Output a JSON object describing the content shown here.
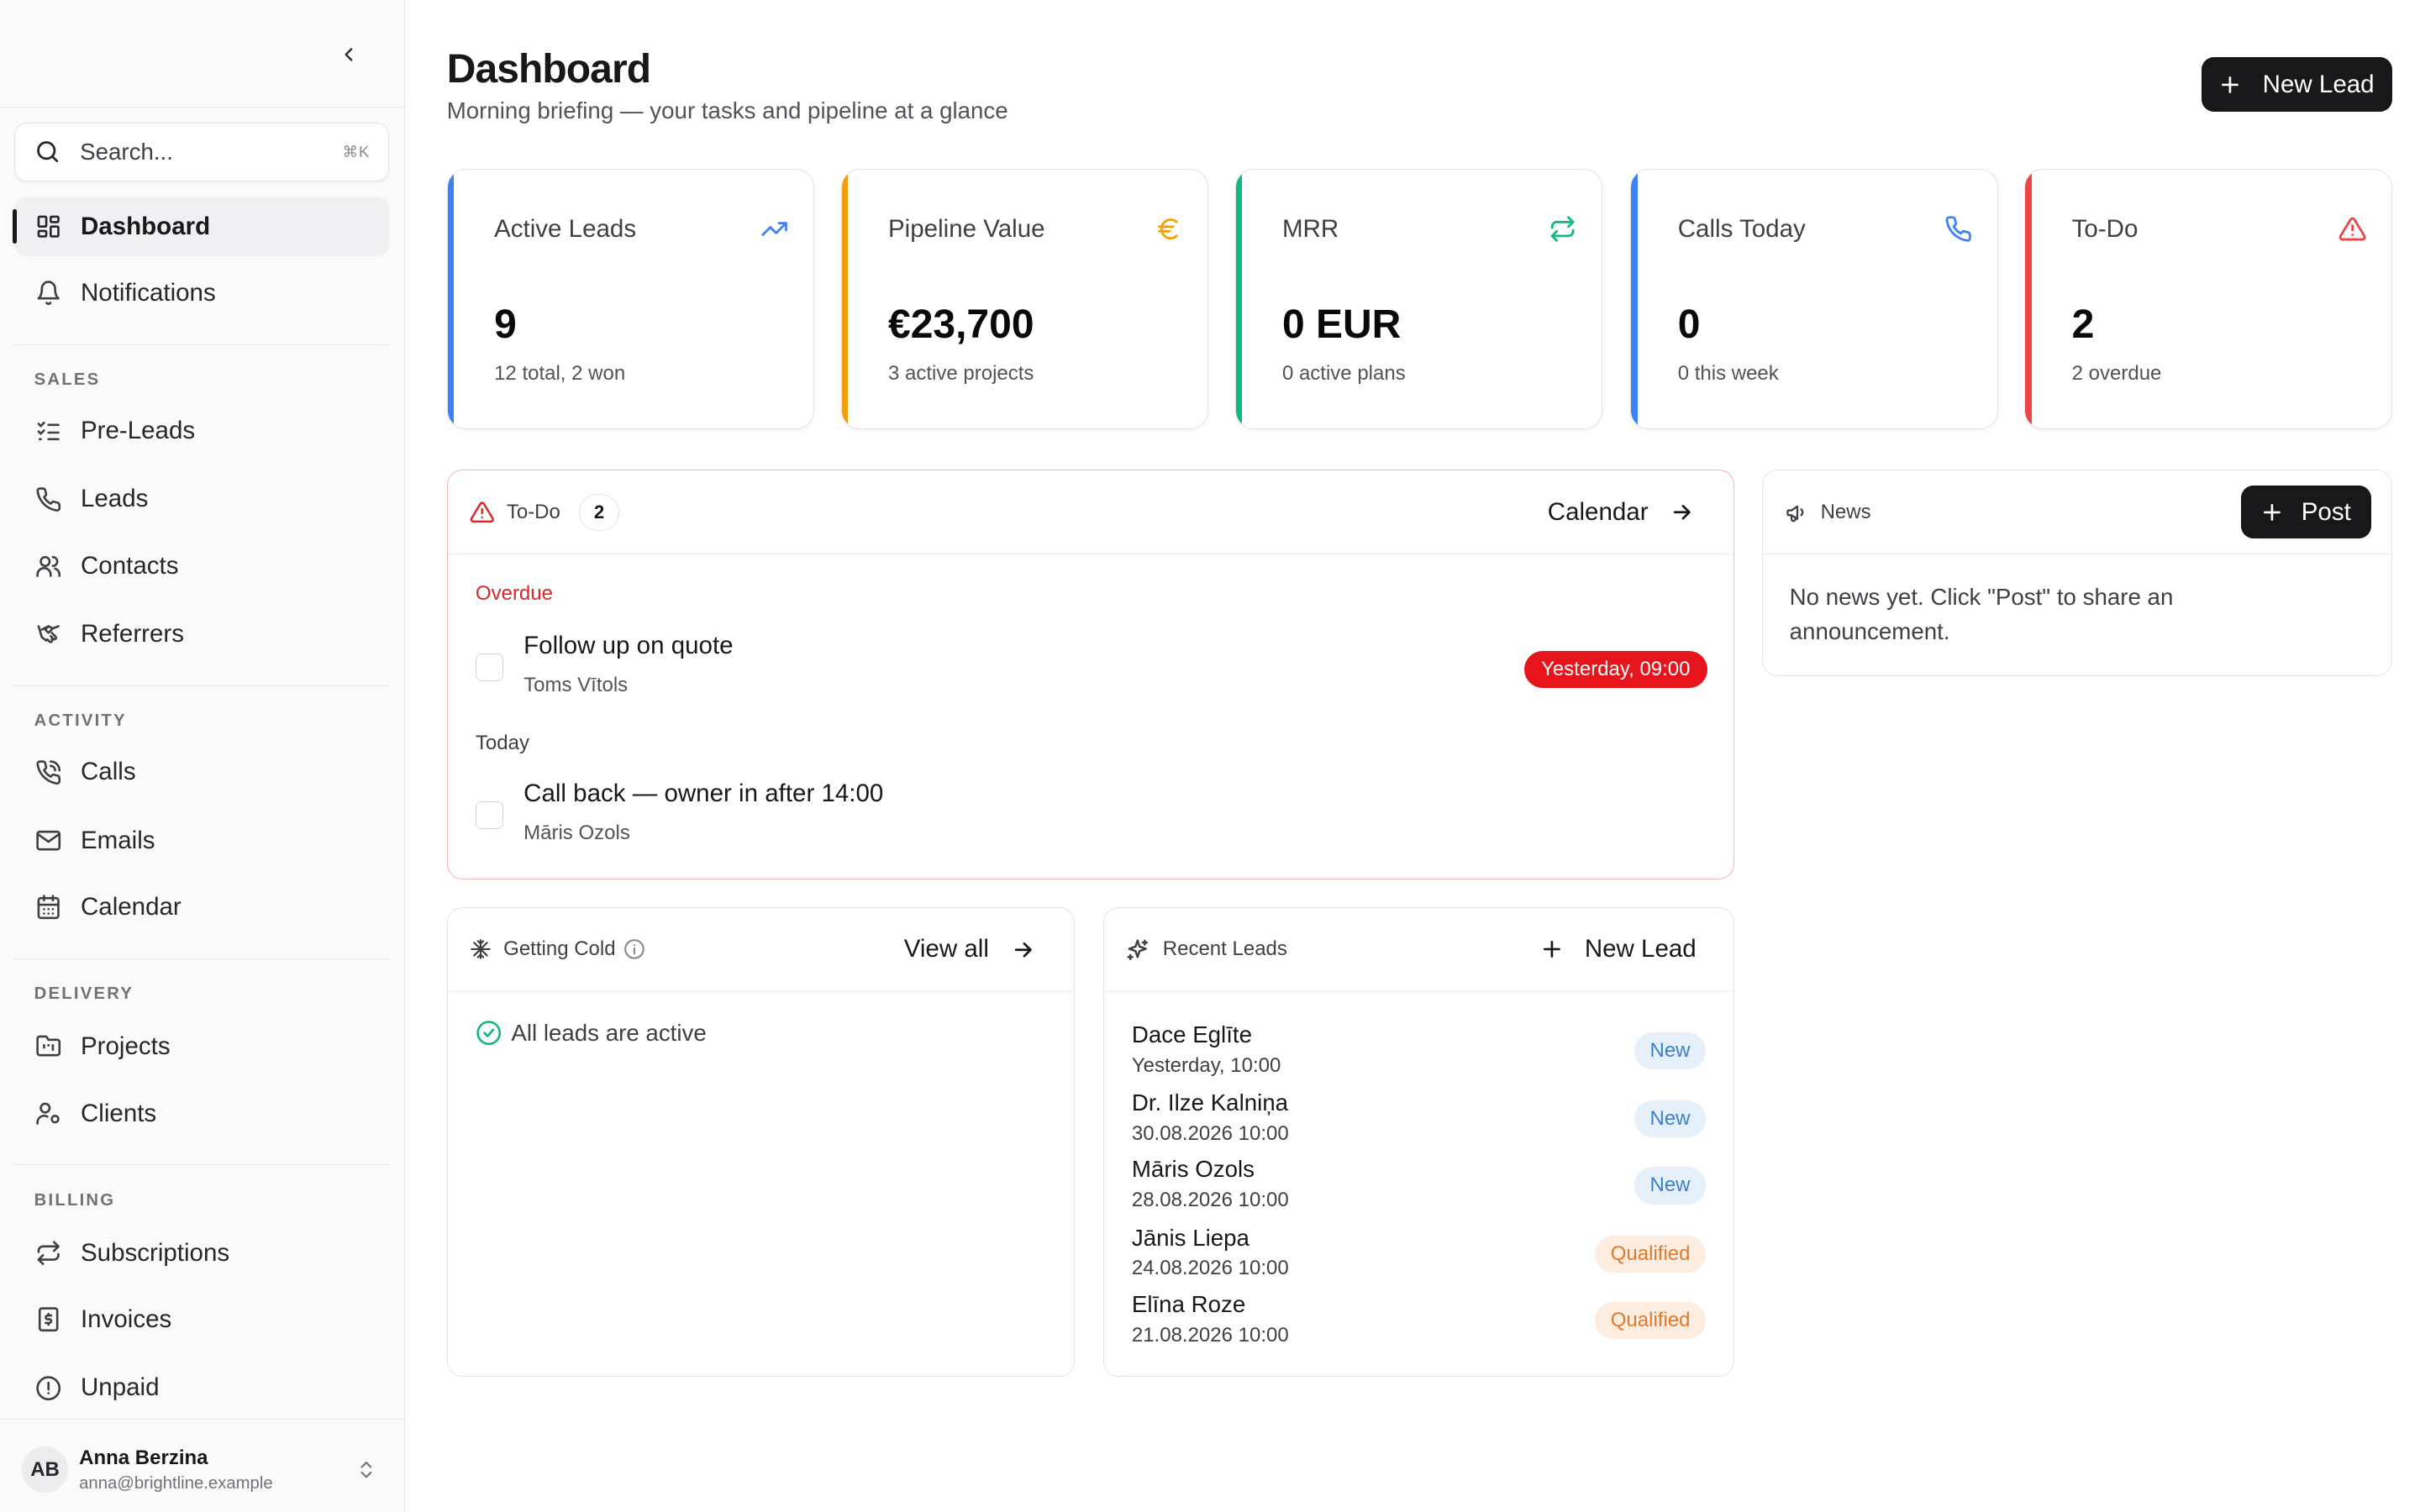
{
  "sidebar": {
    "search": {
      "placeholder": "Search...",
      "shortcut": "⌘K"
    },
    "top_items": [
      {
        "label": "Dashboard",
        "icon": "layout-dashboard-icon",
        "active": true
      },
      {
        "label": "Notifications",
        "icon": "bell-icon"
      }
    ],
    "groups": [
      {
        "label": "SALES",
        "items": [
          {
            "label": "Pre-Leads",
            "icon": "list-checks-icon"
          },
          {
            "label": "Leads",
            "icon": "phone-icon"
          },
          {
            "label": "Contacts",
            "icon": "users-icon"
          },
          {
            "label": "Referrers",
            "icon": "handshake-icon"
          }
        ]
      },
      {
        "label": "ACTIVITY",
        "items": [
          {
            "label": "Calls",
            "icon": "phone-call-icon"
          },
          {
            "label": "Emails",
            "icon": "mail-icon"
          },
          {
            "label": "Calendar",
            "icon": "calendar-icon"
          }
        ]
      },
      {
        "label": "DELIVERY",
        "items": [
          {
            "label": "Projects",
            "icon": "folder-kanban-icon"
          },
          {
            "label": "Clients",
            "icon": "user-cog-icon"
          }
        ]
      },
      {
        "label": "BILLING",
        "items": [
          {
            "label": "Subscriptions",
            "icon": "repeat-icon"
          },
          {
            "label": "Invoices",
            "icon": "receipt-icon"
          },
          {
            "label": "Unpaid",
            "icon": "alert-circle-icon"
          }
        ]
      }
    ],
    "user": {
      "initials": "AB",
      "name": "Anna Berzina",
      "email": "anna@brightline.example"
    }
  },
  "header": {
    "title": "Dashboard",
    "subtitle": "Morning briefing — your tasks and pipeline at a glance",
    "new_lead_label": "New Lead"
  },
  "stats": [
    {
      "label": "Active Leads",
      "value": "9",
      "sub": "12 total, 2 won",
      "icon": "trending-up-icon",
      "color": "#3b82f6"
    },
    {
      "label": "Pipeline Value",
      "value": "€23,700",
      "sub": "3 active projects",
      "icon": "euro-icon",
      "color": "#f59e0b"
    },
    {
      "label": "MRR",
      "value": "0 EUR",
      "sub": "0 active plans",
      "icon": "repeat-icon",
      "color": "#10b981"
    },
    {
      "label": "Calls Today",
      "value": "0",
      "sub": "0 this week",
      "icon": "phone-icon",
      "color": "#3b82f6"
    },
    {
      "label": "To-Do",
      "value": "2",
      "sub": "2 overdue",
      "icon": "alert-triangle-icon",
      "color": "#ef4444"
    }
  ],
  "todo": {
    "title": "To-Do",
    "count": "2",
    "calendar_link": "Calendar",
    "overdue_label": "Overdue",
    "today_label": "Today",
    "overdue_tasks": [
      {
        "title": "Follow up on quote",
        "person": "Toms Vītols",
        "due": "Yesterday, 09:00"
      }
    ],
    "today_tasks": [
      {
        "title": "Call back — owner in after 14:00",
        "person": "Māris Ozols"
      }
    ]
  },
  "news": {
    "title": "News",
    "post_label": "Post",
    "empty_text": "No news yet. Click \"Post\" to share an announcement."
  },
  "getting_cold": {
    "title": "Getting Cold",
    "view_all": "View all",
    "empty_text": "All leads are active"
  },
  "recent_leads": {
    "title": "Recent Leads",
    "new_lead_label": "New Lead",
    "items": [
      {
        "name": "Dace Eglīte",
        "date": "Yesterday, 10:00",
        "status": "New"
      },
      {
        "name": "Dr. Ilze Kalniņa",
        "date": "30.08.2026 10:00",
        "status": "New"
      },
      {
        "name": "Māris Ozols",
        "date": "28.08.2026 10:00",
        "status": "New"
      },
      {
        "name": "Jānis Liepa",
        "date": "24.08.2026 10:00",
        "status": "Qualified"
      },
      {
        "name": "Elīna Roze",
        "date": "21.08.2026 10:00",
        "status": "Qualified"
      }
    ]
  }
}
